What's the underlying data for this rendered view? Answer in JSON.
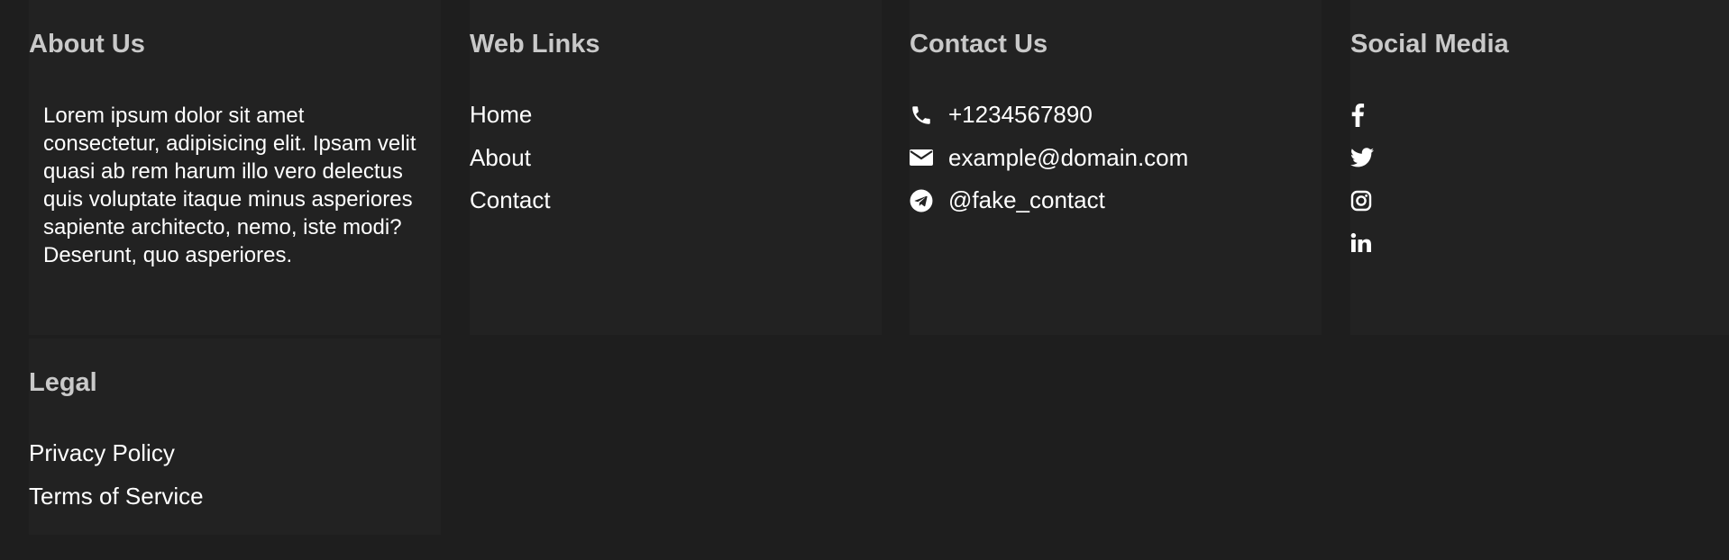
{
  "about": {
    "title": "About Us",
    "text": "Lorem ipsum dolor sit amet consectetur, adipisicing elit. Ipsam velit quasi ab rem harum illo vero delectus quis voluptate itaque minus asperiores sapiente architecto, nemo, iste modi? Deserunt, quo asperiores."
  },
  "web_links": {
    "title": "Web Links",
    "items": [
      {
        "label": "Home"
      },
      {
        "label": "About"
      },
      {
        "label": "Contact"
      }
    ]
  },
  "contact": {
    "title": "Contact Us",
    "items": [
      {
        "icon": "phone-icon",
        "value": "+1234567890"
      },
      {
        "icon": "envelope-icon",
        "value": "example@domain.com"
      },
      {
        "icon": "telegram-icon",
        "value": "@fake_contact"
      }
    ]
  },
  "social": {
    "title": "Social Media",
    "items": [
      {
        "icon": "facebook-icon"
      },
      {
        "icon": "twitter-icon"
      },
      {
        "icon": "instagram-icon"
      },
      {
        "icon": "linkedin-icon"
      }
    ]
  },
  "legal": {
    "title": "Legal",
    "items": [
      {
        "label": "Privacy Policy"
      },
      {
        "label": "Terms of Service"
      }
    ]
  },
  "colors": {
    "page_background": "#1e1e1e",
    "column_background": "#222222",
    "heading": "#c9c9c9",
    "text": "#ffffff"
  }
}
